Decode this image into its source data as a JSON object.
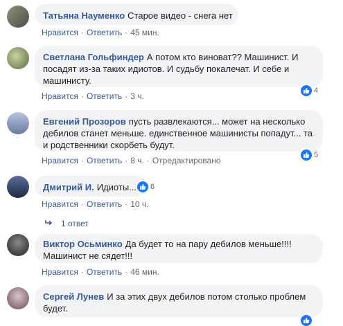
{
  "comments": [
    {
      "author": "Татьяна Науменко",
      "text": "Старое видео - снега нет",
      "like": "Нравится",
      "reply": "Ответить",
      "time": "45 мин.",
      "reactions": "",
      "avatar_color": "#6d6f60"
    },
    {
      "author": "Светлана Гольфиндер",
      "text": "А потом кто виноват?? Машинист. И посадят из-за таких идиотов. И судьбу покалечат. И себе и машинисту.",
      "like": "Нравится",
      "reply": "Ответить",
      "time": "3 ч.",
      "reactions": "4",
      "avatar_color": "#8a9a6a"
    },
    {
      "author": "Евгений Прозоров",
      "text": "пусть развлекаются... может на несколько дебилов станет меньше. единственное машинисты попадут... та и родственники скорбеть будут.",
      "like": "Нравится",
      "reply": "Ответить",
      "time": "8 ч.",
      "edited": "Отредактировано",
      "reactions": "5",
      "avatar_color": "#7d8aa8"
    },
    {
      "author": "Дмитрий И.",
      "text": "Идиоты...",
      "like": "Нравится",
      "reply": "Ответить",
      "time": "10 ч.",
      "reactions": "6",
      "replies_link": "1 ответ",
      "avatar_color": "#3a4a6a"
    },
    {
      "author": "Виктор Осьминко",
      "text": "Да будет то на пару дебилов меньше!!!! Машинист не сядет!!!",
      "like": "Нравится",
      "reply": "Ответить",
      "time": "46 мин.",
      "reactions": "",
      "avatar_color": "#4a4a4a"
    },
    {
      "author": "Сергей Лунев",
      "text": "И за этих двух дебилов потом столько проблем будет.",
      "like": "",
      "reply": "",
      "time": "",
      "reactions": "",
      "avatar_color": "#8a7a88"
    }
  ],
  "colors": {
    "accent": "#385898",
    "bubble": "#f2f3f5",
    "like_badge": "#1877f2"
  }
}
